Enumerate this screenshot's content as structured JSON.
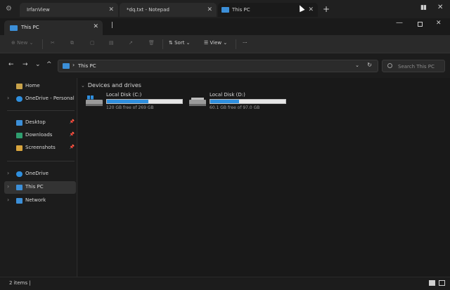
{
  "os_tabs": [
    {
      "label": "IrfanView"
    },
    {
      "label": "*dq.txt - Notepad"
    },
    {
      "label": "This PC"
    }
  ],
  "explorer": {
    "tab_label": "This PC",
    "toolbar": {
      "new_label": "New",
      "sort_label": "Sort",
      "view_label": "View",
      "more_label": "···"
    },
    "address": "This PC",
    "search_placeholder": "Search This PC"
  },
  "sidebar": {
    "items": [
      {
        "label": "Home",
        "icon": "home-icon",
        "expandable": false
      },
      {
        "label": "OneDrive - Personal",
        "icon": "cloud-icon",
        "expandable": true
      },
      {
        "label": "Desktop",
        "icon": "desktop-folder-icon",
        "pinned": true
      },
      {
        "label": "Downloads",
        "icon": "downloads-folder-icon",
        "pinned": true
      },
      {
        "label": "Screenshots",
        "icon": "folder-icon",
        "pinned": true
      },
      {
        "label": "OneDrive",
        "icon": "cloud-icon",
        "expandable": true
      },
      {
        "label": "This PC",
        "icon": "computer-icon",
        "expandable": true,
        "active": true
      },
      {
        "label": "Network",
        "icon": "network-icon",
        "expandable": true
      }
    ]
  },
  "content": {
    "section_title": "Devices and drives",
    "drives": [
      {
        "name": "Local Disk (C:)",
        "free_text": "120 GB free of 269 GB",
        "used_fraction": 0.55,
        "bar_color": "#2f8fde"
      },
      {
        "name": "Local Disk (D:)",
        "free_text": "60.1 GB free of 97.0 GB",
        "used_fraction": 0.38,
        "bar_color": "#2f8fde"
      }
    ]
  },
  "status": {
    "count": "2 items"
  }
}
